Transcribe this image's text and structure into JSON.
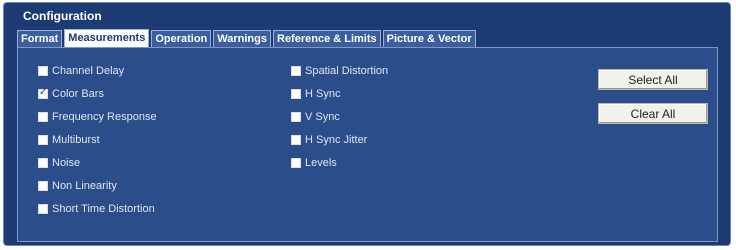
{
  "window": {
    "title": "Configuration"
  },
  "tabs": [
    {
      "label": "Format",
      "active": false
    },
    {
      "label": "Measurements",
      "active": true
    },
    {
      "label": "Operation",
      "active": false
    },
    {
      "label": "Warnings",
      "active": false
    },
    {
      "label": "Reference & Limits",
      "active": false
    },
    {
      "label": "Picture & Vector",
      "active": false
    }
  ],
  "measurements": {
    "left_column": [
      {
        "label": "Channel Delay",
        "checked": false
      },
      {
        "label": "Color Bars",
        "checked": true
      },
      {
        "label": "Frequency Response",
        "checked": false
      },
      {
        "label": "Multiburst",
        "checked": false
      },
      {
        "label": "Noise",
        "checked": false
      },
      {
        "label": "Non Linearity",
        "checked": false
      },
      {
        "label": "Short Time Distortion",
        "checked": false
      }
    ],
    "right_column": [
      {
        "label": "Spatial Distortion",
        "checked": false
      },
      {
        "label": "H Sync",
        "checked": false
      },
      {
        "label": "V Sync",
        "checked": false
      },
      {
        "label": "H Sync Jitter",
        "checked": false
      },
      {
        "label": "Levels",
        "checked": false
      }
    ]
  },
  "buttons": {
    "select_all": "Select All",
    "clear_all": "Clear All"
  },
  "colors": {
    "window_bg": "#1d3b73",
    "panel_bg": "#2b4d8a",
    "tab_bg": "#3b5f9e",
    "active_tab_bg": "#ffffff"
  }
}
